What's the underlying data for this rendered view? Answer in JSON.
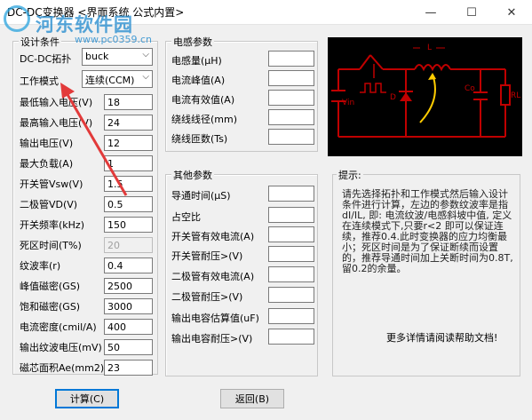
{
  "window": {
    "title": "DC-DC变换器  <界面系统  公式内置>",
    "controls": {
      "min": "—",
      "max": "☐",
      "close": "✕"
    }
  },
  "watermark": {
    "title": "河东软件园",
    "url": "www.pc0359.cn"
  },
  "design": {
    "legend": "设计条件",
    "topology": {
      "label": "DC-DC拓扑",
      "value": "buck"
    },
    "mode": {
      "label": "工作模式",
      "value": "连续(CCM)"
    },
    "rows": [
      {
        "label": "最低输入电压(V)",
        "value": "18"
      },
      {
        "label": "最高输入电压(V)",
        "value": "24"
      },
      {
        "label": "输出电压(V)",
        "value": "12"
      },
      {
        "label": "最大负载(A)",
        "value": "1"
      },
      {
        "label": "开关管Vsw(V)",
        "value": "1.5"
      },
      {
        "label": "二极管VD(V)",
        "value": "0.5"
      },
      {
        "label": "开关频率(kHz)",
        "value": "150"
      },
      {
        "label": "死区时间(T%)",
        "value": "20"
      },
      {
        "label": "纹波率(r)",
        "value": "0.4"
      },
      {
        "label": "峰值磁密(GS)",
        "value": "2500"
      },
      {
        "label": "饱和磁密(GS)",
        "value": "3000"
      },
      {
        "label": "电流密度(cmil/A)",
        "value": "400"
      },
      {
        "label": "输出纹波电压(mV)",
        "value": "50"
      },
      {
        "label": "磁芯面积Ae(mm2)",
        "value": "23"
      }
    ]
  },
  "inductor": {
    "legend": "电感参数",
    "rows": [
      {
        "label": "电感量(μH)",
        "value": ""
      },
      {
        "label": "电流峰值(A)",
        "value": ""
      },
      {
        "label": "电流有效值(A)",
        "value": ""
      },
      {
        "label": "绕线线径(mm)",
        "value": ""
      },
      {
        "label": "绕线匝数(Ts)",
        "value": ""
      }
    ]
  },
  "other": {
    "legend": "其他参数",
    "rows": [
      {
        "label": "导通时间(μS)",
        "value": ""
      },
      {
        "label": "占空比",
        "value": ""
      },
      {
        "label": "开关管有效电流(A)",
        "value": ""
      },
      {
        "label": "开关管耐压>(V)",
        "value": ""
      },
      {
        "label": "二极管有效电流(A)",
        "value": ""
      },
      {
        "label": "二极管耐压>(V)",
        "value": ""
      },
      {
        "label": "输出电容估算值(uF)",
        "value": ""
      },
      {
        "label": "输出电容耐压>(V)",
        "value": ""
      }
    ]
  },
  "schematic": {
    "labels": {
      "L": "L",
      "Vin": "Vin",
      "D": "D",
      "Co": "Co",
      "RL": "RL"
    }
  },
  "tips": {
    "legend": "提示:",
    "text": "请先选择拓扑和工作模式然后输入设计条件进行计算，左边的参数纹波率是指  dI/IL, 即:  电流纹波/电感斜坡中值,  定义在连续模式下,只要r<2 即可以保证连续，推荐0.4.此时变换器的应力均衡最小；死区时间是为了保证断续而设置的，推荐导通时间加上关断时间为0.8T, 留0.2的余量。",
    "more": "更多详情请阅读帮助文档!"
  },
  "buttons": {
    "calc": "计算(C)",
    "back": "返回(B)"
  },
  "colors": {
    "schematic_bg": "#000000",
    "wire": "#c00000",
    "annotation": "#e23a3a",
    "arrow": "#ffcc00"
  }
}
